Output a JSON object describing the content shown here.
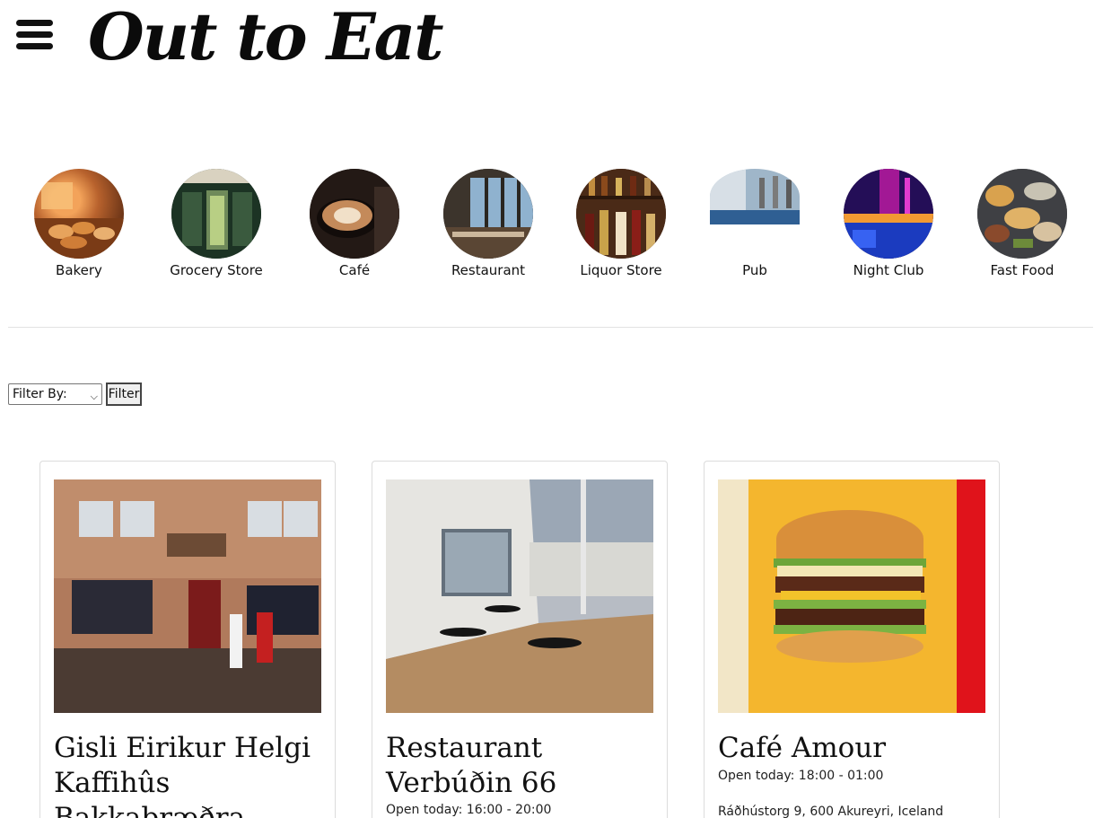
{
  "header": {
    "menu_icon": "hamburger-menu-icon",
    "logo": "Out to Eat"
  },
  "categories": [
    {
      "label": "Bakery",
      "image": "bakery-photo"
    },
    {
      "label": "Grocery Store",
      "image": "grocery-store-photo"
    },
    {
      "label": "Café",
      "image": "cafe-photo"
    },
    {
      "label": "Restaurant",
      "image": "restaurant-photo"
    },
    {
      "label": "Liquor Store",
      "image": "liquor-store-photo"
    },
    {
      "label": "Pub",
      "image": "pub-photo"
    },
    {
      "label": "Night Club",
      "image": "night-club-photo"
    },
    {
      "label": "Fast Food",
      "image": "fast-food-photo"
    }
  ],
  "filter": {
    "select_value": "Filter By:",
    "button_label": "Filter"
  },
  "cards": [
    {
      "title": "Gisli Eirikur Helgi Kaffihûs Bakkabræðra",
      "hours": "",
      "address": ""
    },
    {
      "title": "Restaurant Verbúðin 66",
      "hours": "Open today: 16:00 - 20:00",
      "address": ""
    },
    {
      "title": "Café Amour",
      "hours": "Open today: 18:00 - 01:00",
      "address": "Ráðhústorg 9, 600 Akureyri, Iceland"
    }
  ],
  "colors": {
    "text": "#111111",
    "divider": "#e3e3e3",
    "card_border": "#dcdcdc",
    "burger_bg": "#f4b62e",
    "burger_red": "#e0131b"
  }
}
